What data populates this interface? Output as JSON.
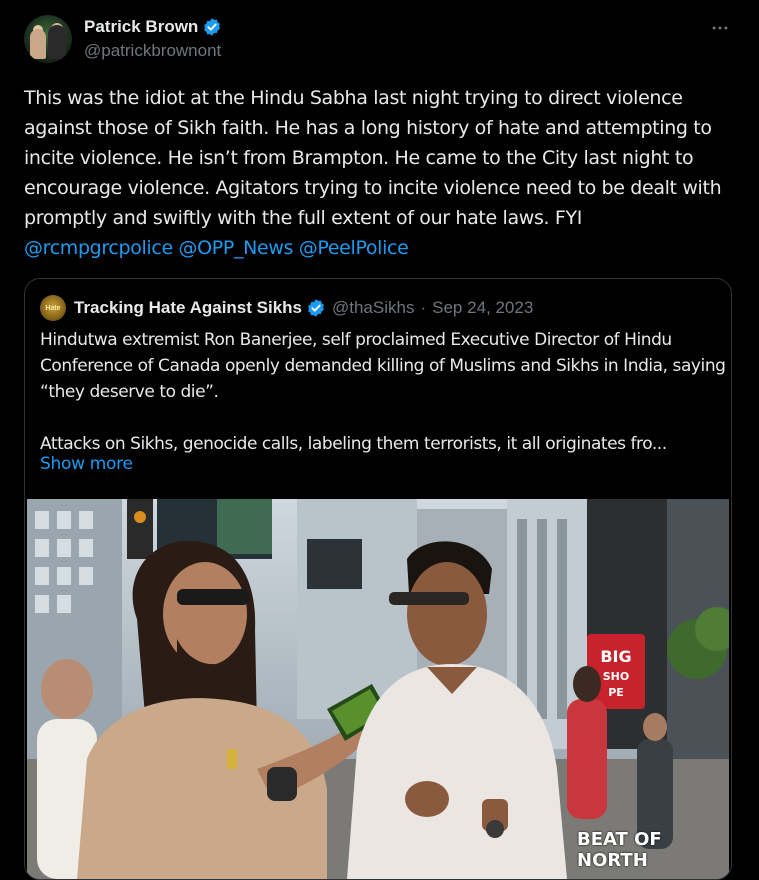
{
  "author": {
    "display_name": "Patrick Brown",
    "handle": "@patrickbrownont",
    "avatar_icon": "profile-photo",
    "verified_icon": "verified-badge-icon"
  },
  "more_icon": "ellipsis-icon",
  "tweet": {
    "body": "This was the idiot at the Hindu Sabha last night trying to direct violence against those of Sikh faith. He has a long history of hate and attempting to incite violence. He isn’t from Brampton. He came to the City last night to encourage violence. Agitators trying to incite violence need to be dealt with promptly and swiftly with the full extent of our hate laws. FYI ",
    "mentions": [
      "@rcmpgrcpolice",
      "@OPP_News",
      "@PeelPolice"
    ]
  },
  "quoted": {
    "display_name": "Tracking Hate Against Sikhs",
    "handle": "@thaSikhs",
    "separator": "·",
    "date": "Sep 24, 2023",
    "avatar_text": "Hate",
    "paragraph_1": "Hindutwa extremist Ron Banerjee, self proclaimed Executive Director of Hindu Conference of Canada openly demanded killing of Muslims and Sikhs in India, saying “they deserve to die”.",
    "paragraph_2": "Attacks on Sikhs, genocide calls, labeling them terrorists, it all originates fro...",
    "show_more": "Show more",
    "media": {
      "sign_text": "BIG SHO PE",
      "watermark": "BEAT OF NORTH"
    }
  },
  "colors": {
    "background": "#000000",
    "text": "#e7e9ea",
    "secondary": "#71767b",
    "accent": "#1d9bf0",
    "border": "#2f3336"
  }
}
